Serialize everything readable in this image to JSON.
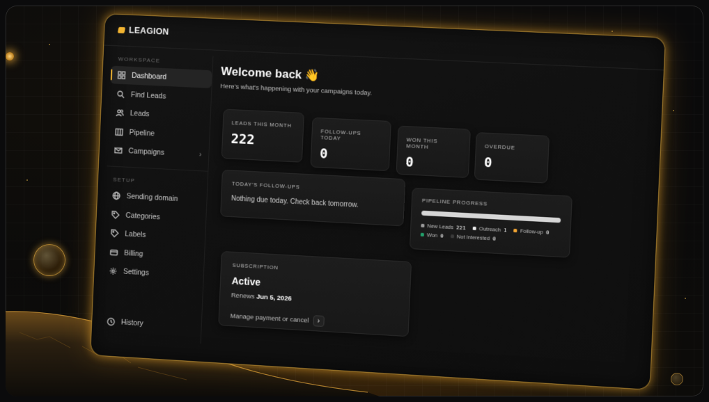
{
  "app": {
    "name": "LEAGION"
  },
  "sidebar": {
    "workspace_label": "WORKSPACE",
    "setup_label": "SETUP",
    "workspace_items": [
      {
        "label": "Dashboard",
        "icon": "dashboard-grid-icon",
        "active": true
      },
      {
        "label": "Find Leads",
        "icon": "search-icon"
      },
      {
        "label": "Leads",
        "icon": "users-icon"
      },
      {
        "label": "Pipeline",
        "icon": "pipeline-icon"
      },
      {
        "label": "Campaigns",
        "icon": "mail-icon",
        "has_submenu": true
      }
    ],
    "setup_items": [
      {
        "label": "Sending domain",
        "icon": "globe-icon"
      },
      {
        "label": "Categories",
        "icon": "tags-icon"
      },
      {
        "label": "Labels",
        "icon": "tag-icon"
      },
      {
        "label": "Billing",
        "icon": "credit-card-icon"
      },
      {
        "label": "Settings",
        "icon": "gear-icon"
      }
    ],
    "history": {
      "label": "History",
      "icon": "clock-icon"
    }
  },
  "header": {
    "title": "Welcome back",
    "emoji": "👋",
    "subtitle": "Here's what's happening with your campaigns today."
  },
  "stats": [
    {
      "label": "LEADS THIS MONTH",
      "value": "222"
    },
    {
      "label": "FOLLOW-UPS TODAY",
      "value": "0"
    },
    {
      "label": "WON THIS MONTH",
      "value": "0"
    },
    {
      "label": "OVERDUE",
      "value": "0"
    }
  ],
  "followups": {
    "label": "TODAY'S FOLLOW-UPS",
    "message": "Nothing due today. Check back tomorrow."
  },
  "pipeline": {
    "label": "PIPELINE PROGRESS",
    "legend": [
      {
        "name": "New Leads",
        "value": "221",
        "color": "#9a9a9a"
      },
      {
        "name": "Outreach",
        "value": "1",
        "color": "#e8e8e8"
      },
      {
        "name": "Follow-up",
        "value": "0",
        "color": "#f2a533"
      },
      {
        "name": "Won",
        "value": "0",
        "color": "#22a06b"
      },
      {
        "name": "Not Interested",
        "value": "0",
        "color": "#3a3a3a"
      }
    ]
  },
  "subscription": {
    "label": "SUBSCRIPTION",
    "status": "Active",
    "renews_prefix": "Renews",
    "renews_date": "Jun 5, 2026",
    "manage_label": "Manage payment or cancel",
    "manage_button": "›"
  },
  "colors": {
    "accent": "#f2b431",
    "card_bg": "#1b1b1b",
    "glow": "#f5af32"
  }
}
